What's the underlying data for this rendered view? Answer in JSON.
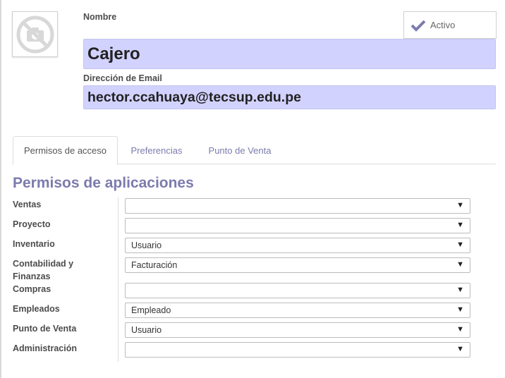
{
  "user": {
    "name_label": "Nombre",
    "name": "Cajero",
    "email_label": "Dirección de Email",
    "email": "hector.ccahuaya@tecsup.edu.pe",
    "active_label": "Activo"
  },
  "tabs": [
    {
      "label": "Permisos de acceso",
      "active": true
    },
    {
      "label": "Preferencias",
      "active": false
    },
    {
      "label": "Punto de Venta",
      "active": false
    }
  ],
  "permissions": {
    "title": "Permisos de aplicaciones",
    "rows": [
      {
        "label": "Ventas",
        "value": ""
      },
      {
        "label": "Proyecto",
        "value": ""
      },
      {
        "label": "Inventario",
        "value": "Usuario"
      },
      {
        "label": "Contabilidad y Finanzas",
        "value": "Facturación"
      },
      {
        "label": "Compras",
        "value": ""
      },
      {
        "label": "Empleados",
        "value": "Empleado"
      },
      {
        "label": "Punto de Venta",
        "value": "Usuario"
      },
      {
        "label": "Administración",
        "value": ""
      }
    ]
  },
  "dropdown_arrow": "▼",
  "colors": {
    "accent": "#7c7bad",
    "input_highlight": "#d2d2ff"
  }
}
